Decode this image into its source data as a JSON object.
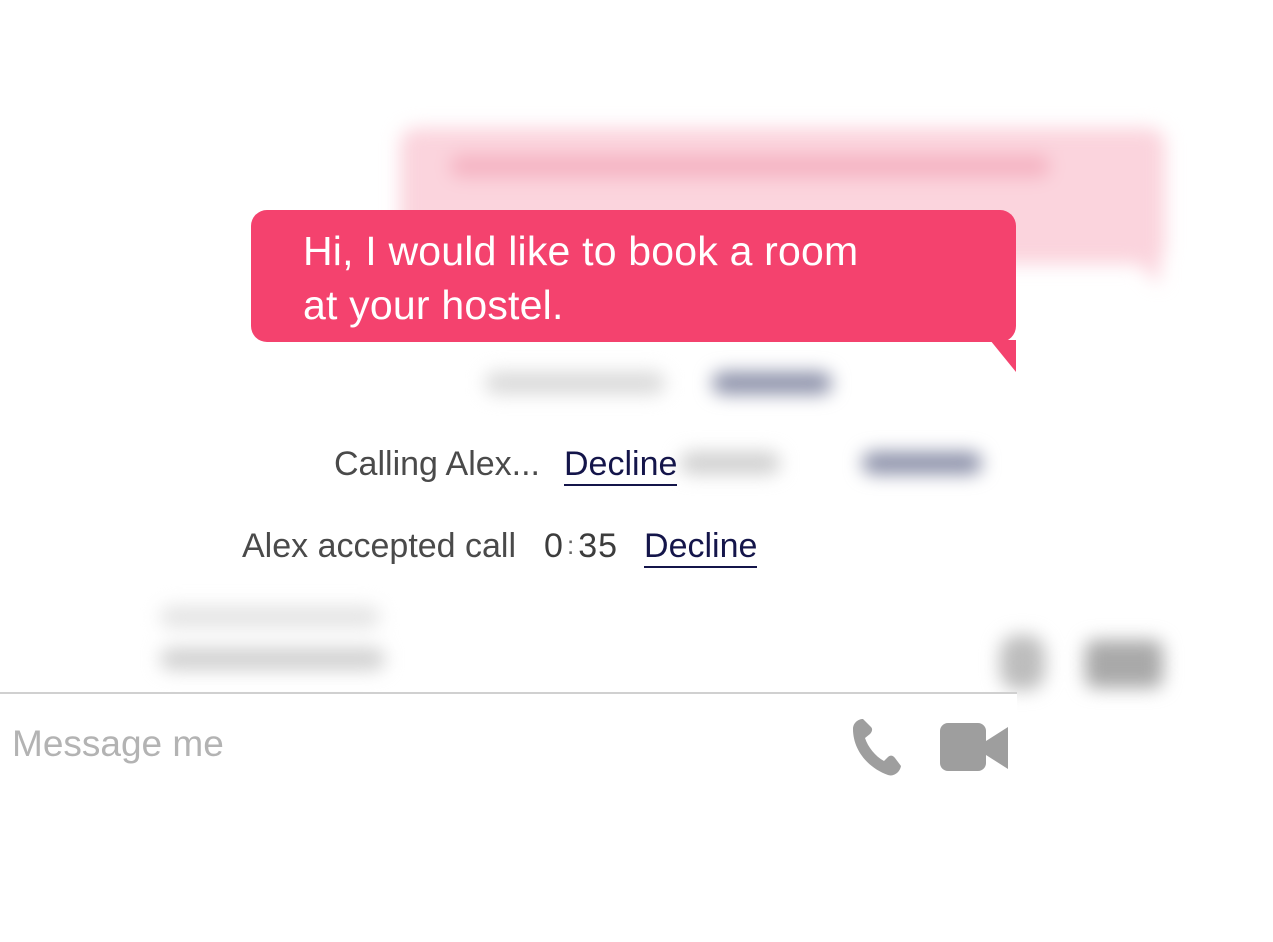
{
  "chat": {
    "message_text": "Hi, I would like to book a room at your hostel.",
    "message_line_1": "Hi, I would like to book a room",
    "message_line_2": "at your hostel.",
    "bubble_color": "#f4426e"
  },
  "calls": {
    "calling_text": "Calling Alex...",
    "calling_decline_label": "Decline",
    "accepted_text": "Alex accepted call",
    "timer_minutes": "0",
    "timer_separator": ":",
    "timer_seconds": "35",
    "accepted_decline_label": "Decline",
    "link_color": "#14154a"
  },
  "composer": {
    "placeholder": "Message me",
    "value": "",
    "icons": [
      "phone-icon",
      "video-camera-icon"
    ],
    "icon_color": "#9e9e9e"
  }
}
